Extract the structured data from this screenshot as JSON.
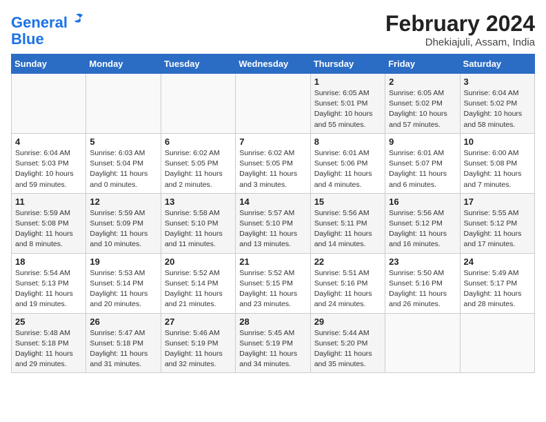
{
  "header": {
    "logo_line1": "General",
    "logo_line2": "Blue",
    "month_year": "February 2024",
    "location": "Dhekiajuli, Assam, India"
  },
  "weekdays": [
    "Sunday",
    "Monday",
    "Tuesday",
    "Wednesday",
    "Thursday",
    "Friday",
    "Saturday"
  ],
  "weeks": [
    [
      {
        "day": "",
        "info": ""
      },
      {
        "day": "",
        "info": ""
      },
      {
        "day": "",
        "info": ""
      },
      {
        "day": "",
        "info": ""
      },
      {
        "day": "1",
        "info": "Sunrise: 6:05 AM\nSunset: 5:01 PM\nDaylight: 10 hours\nand 55 minutes."
      },
      {
        "day": "2",
        "info": "Sunrise: 6:05 AM\nSunset: 5:02 PM\nDaylight: 10 hours\nand 57 minutes."
      },
      {
        "day": "3",
        "info": "Sunrise: 6:04 AM\nSunset: 5:02 PM\nDaylight: 10 hours\nand 58 minutes."
      }
    ],
    [
      {
        "day": "4",
        "info": "Sunrise: 6:04 AM\nSunset: 5:03 PM\nDaylight: 10 hours\nand 59 minutes."
      },
      {
        "day": "5",
        "info": "Sunrise: 6:03 AM\nSunset: 5:04 PM\nDaylight: 11 hours\nand 0 minutes."
      },
      {
        "day": "6",
        "info": "Sunrise: 6:02 AM\nSunset: 5:05 PM\nDaylight: 11 hours\nand 2 minutes."
      },
      {
        "day": "7",
        "info": "Sunrise: 6:02 AM\nSunset: 5:05 PM\nDaylight: 11 hours\nand 3 minutes."
      },
      {
        "day": "8",
        "info": "Sunrise: 6:01 AM\nSunset: 5:06 PM\nDaylight: 11 hours\nand 4 minutes."
      },
      {
        "day": "9",
        "info": "Sunrise: 6:01 AM\nSunset: 5:07 PM\nDaylight: 11 hours\nand 6 minutes."
      },
      {
        "day": "10",
        "info": "Sunrise: 6:00 AM\nSunset: 5:08 PM\nDaylight: 11 hours\nand 7 minutes."
      }
    ],
    [
      {
        "day": "11",
        "info": "Sunrise: 5:59 AM\nSunset: 5:08 PM\nDaylight: 11 hours\nand 8 minutes."
      },
      {
        "day": "12",
        "info": "Sunrise: 5:59 AM\nSunset: 5:09 PM\nDaylight: 11 hours\nand 10 minutes."
      },
      {
        "day": "13",
        "info": "Sunrise: 5:58 AM\nSunset: 5:10 PM\nDaylight: 11 hours\nand 11 minutes."
      },
      {
        "day": "14",
        "info": "Sunrise: 5:57 AM\nSunset: 5:10 PM\nDaylight: 11 hours\nand 13 minutes."
      },
      {
        "day": "15",
        "info": "Sunrise: 5:56 AM\nSunset: 5:11 PM\nDaylight: 11 hours\nand 14 minutes."
      },
      {
        "day": "16",
        "info": "Sunrise: 5:56 AM\nSunset: 5:12 PM\nDaylight: 11 hours\nand 16 minutes."
      },
      {
        "day": "17",
        "info": "Sunrise: 5:55 AM\nSunset: 5:12 PM\nDaylight: 11 hours\nand 17 minutes."
      }
    ],
    [
      {
        "day": "18",
        "info": "Sunrise: 5:54 AM\nSunset: 5:13 PM\nDaylight: 11 hours\nand 19 minutes."
      },
      {
        "day": "19",
        "info": "Sunrise: 5:53 AM\nSunset: 5:14 PM\nDaylight: 11 hours\nand 20 minutes."
      },
      {
        "day": "20",
        "info": "Sunrise: 5:52 AM\nSunset: 5:14 PM\nDaylight: 11 hours\nand 21 minutes."
      },
      {
        "day": "21",
        "info": "Sunrise: 5:52 AM\nSunset: 5:15 PM\nDaylight: 11 hours\nand 23 minutes."
      },
      {
        "day": "22",
        "info": "Sunrise: 5:51 AM\nSunset: 5:16 PM\nDaylight: 11 hours\nand 24 minutes."
      },
      {
        "day": "23",
        "info": "Sunrise: 5:50 AM\nSunset: 5:16 PM\nDaylight: 11 hours\nand 26 minutes."
      },
      {
        "day": "24",
        "info": "Sunrise: 5:49 AM\nSunset: 5:17 PM\nDaylight: 11 hours\nand 28 minutes."
      }
    ],
    [
      {
        "day": "25",
        "info": "Sunrise: 5:48 AM\nSunset: 5:18 PM\nDaylight: 11 hours\nand 29 minutes."
      },
      {
        "day": "26",
        "info": "Sunrise: 5:47 AM\nSunset: 5:18 PM\nDaylight: 11 hours\nand 31 minutes."
      },
      {
        "day": "27",
        "info": "Sunrise: 5:46 AM\nSunset: 5:19 PM\nDaylight: 11 hours\nand 32 minutes."
      },
      {
        "day": "28",
        "info": "Sunrise: 5:45 AM\nSunset: 5:19 PM\nDaylight: 11 hours\nand 34 minutes."
      },
      {
        "day": "29",
        "info": "Sunrise: 5:44 AM\nSunset: 5:20 PM\nDaylight: 11 hours\nand 35 minutes."
      },
      {
        "day": "",
        "info": ""
      },
      {
        "day": "",
        "info": ""
      }
    ]
  ]
}
